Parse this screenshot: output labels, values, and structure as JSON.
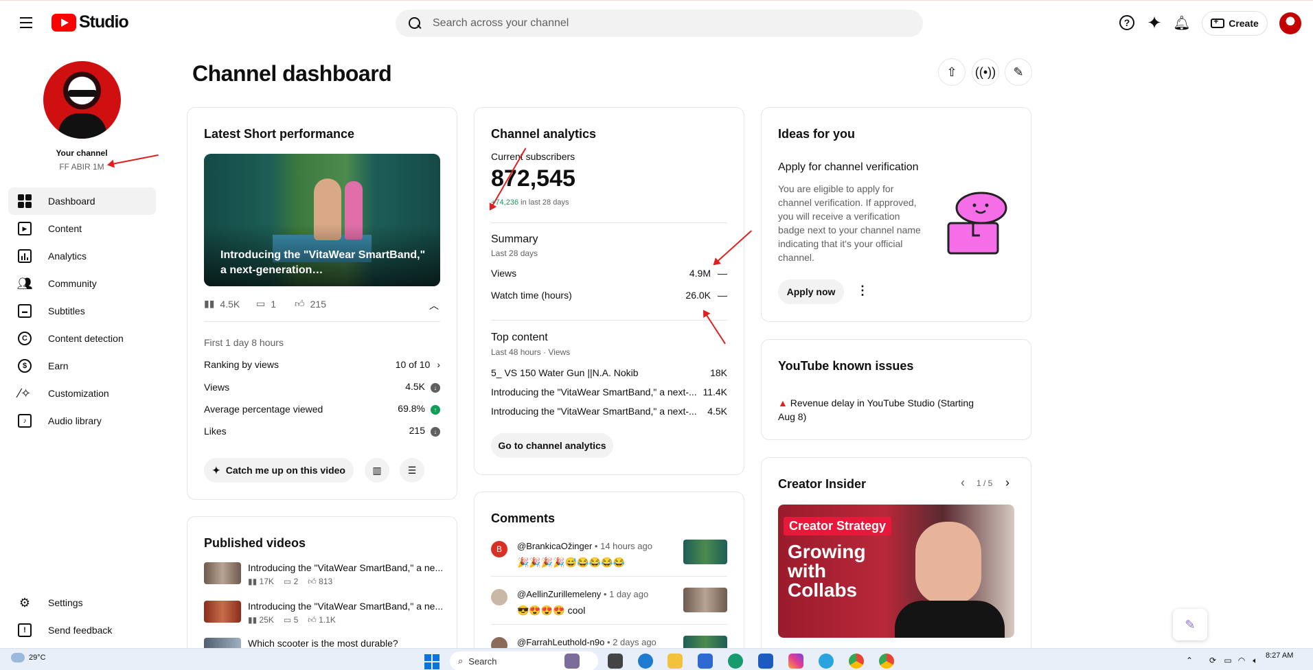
{
  "header": {
    "logo_text": "Studio",
    "search_placeholder": "Search across your channel",
    "create_label": "Create"
  },
  "sidebar": {
    "channel_label": "Your channel",
    "channel_name": "FF ABIR 1M",
    "items": [
      {
        "label": "Dashboard",
        "icon": "dashboard-icon",
        "active": true
      },
      {
        "label": "Content",
        "icon": "content-icon"
      },
      {
        "label": "Analytics",
        "icon": "analytics-icon"
      },
      {
        "label": "Community",
        "icon": "community-icon"
      },
      {
        "label": "Subtitles",
        "icon": "subtitles-icon"
      },
      {
        "label": "Content detection",
        "icon": "copyright-icon"
      },
      {
        "label": "Earn",
        "icon": "dollar-icon"
      },
      {
        "label": "Customization",
        "icon": "magic-wand-icon"
      },
      {
        "label": "Audio library",
        "icon": "audio-library-icon"
      }
    ],
    "bottom": [
      {
        "label": "Settings",
        "icon": "gear-icon"
      },
      {
        "label": "Send feedback",
        "icon": "feedback-icon"
      }
    ]
  },
  "main": {
    "title": "Channel dashboard",
    "latest_short": {
      "title": "Latest Short performance",
      "video_title": "Introducing the \"VitaWear SmartBand,\" a next-generation…",
      "views": "4.5K",
      "comments": "1",
      "likes": "215",
      "period": "First 1 day 8 hours",
      "metrics": [
        {
          "label": "Ranking by views",
          "value": "10 of 10"
        },
        {
          "label": "Views",
          "value": "4.5K"
        },
        {
          "label": "Average percentage viewed",
          "value": "69.8%"
        },
        {
          "label": "Likes",
          "value": "215"
        }
      ],
      "catch_up_label": "Catch me up on this video"
    },
    "published": {
      "title": "Published videos",
      "videos": [
        {
          "title": "Introducing the \"VitaWear SmartBand,\" a ne...",
          "views": "17K",
          "comments": "2",
          "likes": "813"
        },
        {
          "title": "Introducing the \"VitaWear SmartBand,\" a ne...",
          "views": "25K",
          "comments": "5",
          "likes": "1.1K"
        },
        {
          "title": "Which scooter is the most durable?",
          "views": "",
          "comments": "",
          "likes": ""
        }
      ]
    },
    "analytics": {
      "title": "Channel analytics",
      "subs_label": "Current subscribers",
      "subs_value": "872,545",
      "subs_change": "+74,236",
      "subs_change_period": "in last 28 days",
      "summary_title": "Summary",
      "summary_period": "Last 28 days",
      "summary": [
        {
          "label": "Views",
          "value": "4.9M",
          "trend": "—"
        },
        {
          "label": "Watch time (hours)",
          "value": "26.0K",
          "trend": "—"
        }
      ],
      "top_title": "Top content",
      "top_period": "Last 48 hours · Views",
      "top": [
        {
          "title": "5_ VS 150 Water Gun ||N.A. Nokib",
          "value": "18K"
        },
        {
          "title": "Introducing the \"VitaWear SmartBand,\" a next-...",
          "value": "11.4K"
        },
        {
          "title": "Introducing the \"VitaWear SmartBand,\" a next-...",
          "value": "4.5K"
        }
      ],
      "button_label": "Go to channel analytics"
    },
    "comments": {
      "title": "Comments",
      "items": [
        {
          "user": "@BrankicaOžinger",
          "time": "• 14 hours ago",
          "text": "🎉🎉🎉🎉😅😂😂😂😂",
          "initial": "B",
          "color": "#d93025"
        },
        {
          "user": "@AellinZurillemeleny",
          "time": "• 1 day ago",
          "text": "😎😍😍😍 cool",
          "initial": "",
          "color": "#c9b8a6"
        },
        {
          "user": "@FarrahLeuthold-n9o",
          "time": "• 2 days ago",
          "text": "",
          "initial": "",
          "color": "#8a6b5a"
        }
      ]
    },
    "ideas": {
      "title": "Ideas for you",
      "heading": "Apply for channel verification",
      "body": "You are eligible to apply for channel verification. If approved, you will receive a verification badge next to your channel name indicating that it's your official channel.",
      "button_label": "Apply now"
    },
    "issues": {
      "title": "YouTube known issues",
      "item": "Revenue delay in YouTube Studio (Starting Aug 8)"
    },
    "insider": {
      "title": "Creator Insider",
      "pager": "1 / 5",
      "tag": "Creator Strategy",
      "headline": "Growing with Collabs"
    }
  },
  "taskbar": {
    "temp": "29°C",
    "search_label": "Search",
    "time": "8:27 AM"
  },
  "colors": {
    "brand_red": "#ff0000",
    "positive": "#0f9d58",
    "annotation": "#e0201f"
  }
}
